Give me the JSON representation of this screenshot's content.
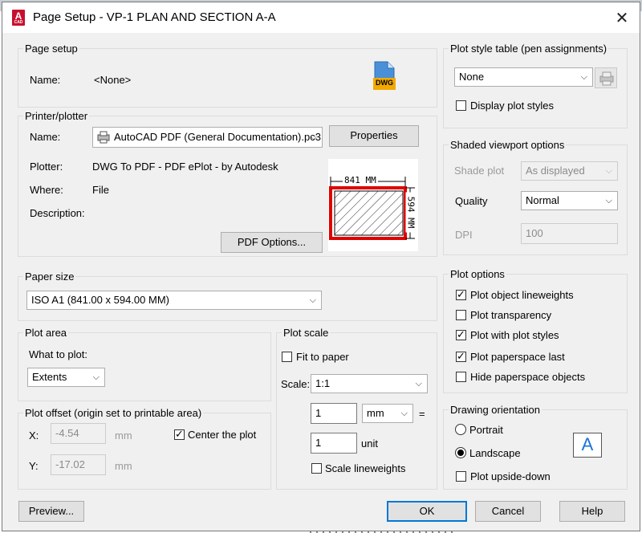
{
  "window": {
    "title": "Page Setup - VP-1 PLAN AND SECTION A-A",
    "close_glyph": "✕"
  },
  "page_setup": {
    "legend": "Page setup",
    "name_label": "Name:",
    "name_value": "<None>",
    "dwg_badge": "DWG"
  },
  "printer": {
    "legend": "Printer/plotter",
    "name_label": "Name:",
    "name_value": "AutoCAD PDF (General Documentation).pc3",
    "properties_label": "Properties",
    "plotter_label": "Plotter:",
    "plotter_value": "DWG To PDF - PDF ePlot - by Autodesk",
    "where_label": "Where:",
    "where_value": "File",
    "description_label": "Description:",
    "pdf_options_label": "PDF Options...",
    "preview_width": "841 MM",
    "preview_height": "594 MM"
  },
  "paper_size": {
    "legend": "Paper size",
    "value": "ISO A1 (841.00 x 594.00 MM)"
  },
  "plot_area": {
    "legend": "Plot area",
    "what_label": "What to plot:",
    "what_value": "Extents"
  },
  "plot_offset": {
    "legend": "Plot offset (origin set to printable area)",
    "x_label": "X:",
    "x_value": "-4.54",
    "x_unit": "mm",
    "y_label": "Y:",
    "y_value": "-17.02",
    "y_unit": "mm",
    "center_label": "Center the plot",
    "center_checked": true
  },
  "plot_scale": {
    "legend": "Plot scale",
    "fit_label": "Fit to paper",
    "fit_checked": false,
    "scale_label": "Scale:",
    "scale_value": "1:1",
    "value1": "1",
    "unit1": "mm",
    "equals": "=",
    "value2": "1",
    "unit2": "unit",
    "lineweights_label": "Scale lineweights",
    "lineweights_checked": false
  },
  "plot_style_table": {
    "legend": "Plot style table (pen assignments)",
    "value": "None",
    "display_label": "Display plot styles",
    "display_checked": false
  },
  "shaded_viewport": {
    "legend": "Shaded viewport options",
    "shade_label": "Shade plot",
    "shade_value": "As displayed",
    "quality_label": "Quality",
    "quality_value": "Normal",
    "dpi_label": "DPI",
    "dpi_value": "100"
  },
  "plot_options": {
    "legend": "Plot options",
    "items": [
      {
        "label": "Plot object lineweights",
        "checked": true
      },
      {
        "label": "Plot transparency",
        "checked": false
      },
      {
        "label": "Plot with plot styles",
        "checked": true
      },
      {
        "label": "Plot paperspace last",
        "checked": true
      },
      {
        "label": "Hide paperspace objects",
        "checked": false
      }
    ]
  },
  "orientation": {
    "legend": "Drawing orientation",
    "portrait_label": "Portrait",
    "landscape_label": "Landscape",
    "selected": "Landscape",
    "upside_down_label": "Plot upside-down",
    "upside_down_checked": false,
    "icon_letter": "A"
  },
  "buttons": {
    "preview": "Preview...",
    "ok": "OK",
    "cancel": "Cancel",
    "help": "Help"
  }
}
